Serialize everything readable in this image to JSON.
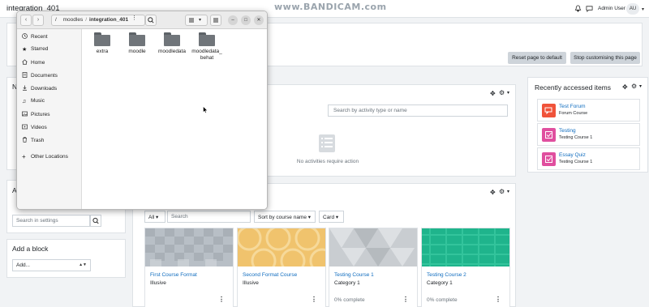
{
  "topbar": {
    "site_title": "integration_401",
    "watermark": "www.BANDICAM.com",
    "user_name": "Admin User",
    "avatar_initials": "AU"
  },
  "header": {
    "reset_button": "Reset page to default",
    "stop_button": "Stop customising this page"
  },
  "left": {
    "nav_initial": "N",
    "admin_initial": "A",
    "search_settings_placeholder": "Search in settings",
    "add_block_title": "Add a block",
    "add_select_value": "Add..."
  },
  "timeline": {
    "search_placeholder": "Search by activity type or name",
    "empty_text": "No activities require action"
  },
  "courses": {
    "filter_all": "All",
    "search_placeholder": "Search",
    "sort_value": "Sort by course name",
    "view_value": "Card",
    "items": [
      {
        "name": "First Course Format",
        "category": "Illusive",
        "progress": "",
        "color": "#b8bfc6"
      },
      {
        "name": "Second Format Course",
        "category": "Illusive",
        "progress": "",
        "color": "#f0c36d"
      },
      {
        "name": "Testing Course 1",
        "category": "Category 1",
        "progress": "0% complete",
        "color": "#c9cdd1"
      },
      {
        "name": "Testing Course 2",
        "category": "Category 1",
        "progress": "0% complete",
        "color": "#1fb48c"
      }
    ]
  },
  "recent": {
    "title": "Recently accessed items",
    "items": [
      {
        "name": "Test Forum",
        "sub": "Forum Course",
        "icon": "forum-icon",
        "color": "#f0533a"
      },
      {
        "name": "Testing",
        "sub": "Testing Course 1",
        "icon": "assignment-icon",
        "color": "#e04f9f"
      },
      {
        "name": "Essay Quiz",
        "sub": "Testing Course 1",
        "icon": "quiz-icon",
        "color": "#e04f9f"
      }
    ]
  },
  "file_manager": {
    "path_root": "/",
    "path_parent": "moodles",
    "path_current": "integration_401",
    "sidebar": [
      "Recent",
      "Starred",
      "Home",
      "Documents",
      "Downloads",
      "Music",
      "Pictures",
      "Videos",
      "Trash",
      "Other Locations"
    ],
    "folders": [
      "extra",
      "moodle",
      "moodledata",
      "moodledata_behat"
    ]
  }
}
